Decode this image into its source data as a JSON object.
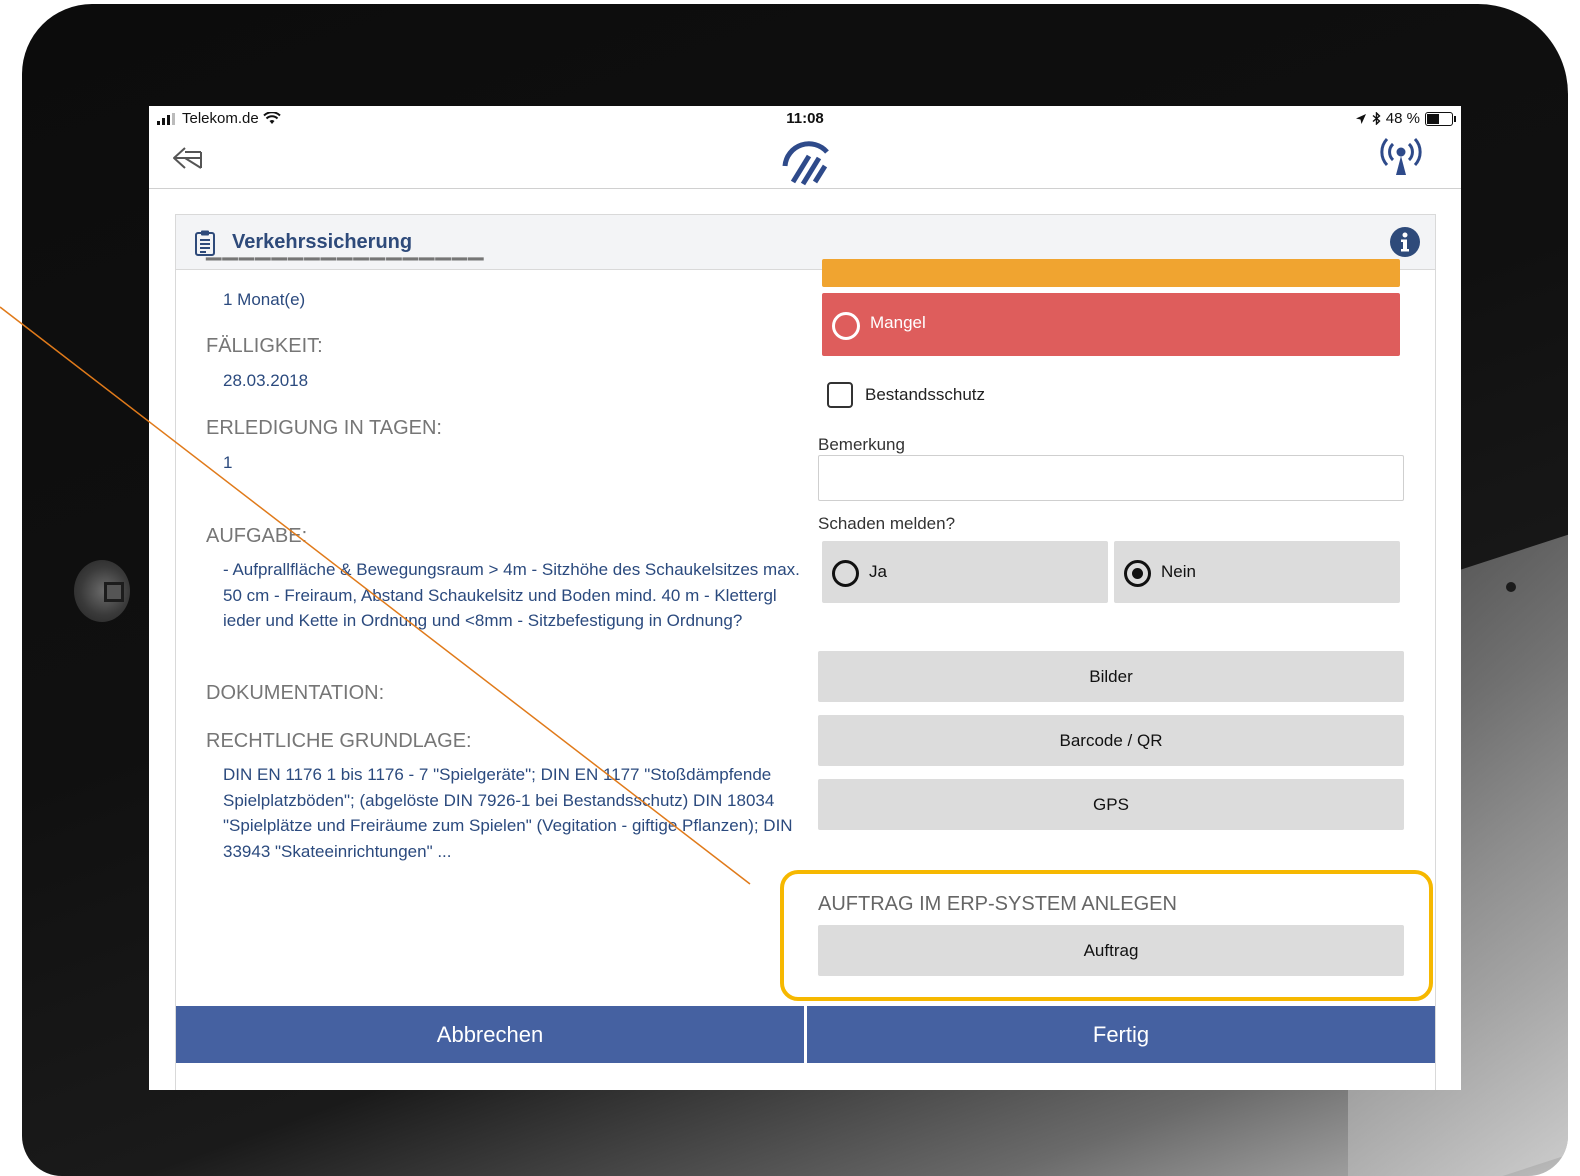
{
  "status_bar": {
    "carrier": "Telekom.de",
    "time": "11:08",
    "battery": "48 %"
  },
  "nav": {
    "back_icon": "back-arrow-icon",
    "logo_icon": "app-logo-icon",
    "sync_icon": "antenna-broadcast-icon"
  },
  "card": {
    "title": "Verkehrssicherung",
    "header_icon": "clipboard-icon",
    "info_icon": "info-icon"
  },
  "details": {
    "interval_value": "1 Monat(e)",
    "due_label": "FÄLLIGKEIT:",
    "due_value": "28.03.2018",
    "days_label": "ERLEDIGUNG IN TAGEN:",
    "days_value": "1",
    "task_label": "AUFGABE:",
    "task_value": "- Aufprallfläche & Bewegungsraum > 4m - Sitzhöhe des Schaukelsitzes max. 50 cm - Freiraum, Abstand Schaukelsitz und Boden mind. 40 m - Klettergl ieder und Kette in Ordnung und <8mm - Sitzbefestigung in Ordnung?",
    "doc_label": "DOKUMENTATION:",
    "legal_label": "RECHTLICHE GRUNDLAGE:",
    "legal_value": "DIN EN 1176 1 bis 1176 - 7 \"Spielgeräte\"; DIN EN 1177 \"Stoßdämpfende Spielplatzböden\"; (abgelöste DIN 7926-1 bei Bestandsschutz) DIN 18034 \"Spielplätze und Freiräume zum Spielen\" (Vegitation - giftige Pflanzen); DIN 33943 \"Skateeinrichtungen\" ..."
  },
  "form": {
    "mangel_label": "Mangel",
    "bestandsschutz_label": "Bestandsschutz",
    "bestandsschutz_checked": false,
    "remark_label": "Bemerkung",
    "remark_value": "",
    "report_label": "Schaden melden?",
    "report_options": [
      "Ja",
      "Nein"
    ],
    "report_selected": "Nein",
    "buttons": [
      "Bilder",
      "Barcode / QR",
      "GPS"
    ],
    "erp_label": "AUFTRAG IM ERP-SYSTEM ANLEGEN",
    "erp_button": "Auftrag"
  },
  "footer": {
    "cancel": "Abbrechen",
    "done": "Fertig"
  },
  "colors": {
    "primary": "#4561a1",
    "title_text": "#2e4a7a",
    "value_text": "#2b4a7e",
    "warning_orange": "#f0a430",
    "defect_red": "#de5d5c",
    "highlight": "#f6b800",
    "annotation_line": "#e07a1a"
  }
}
